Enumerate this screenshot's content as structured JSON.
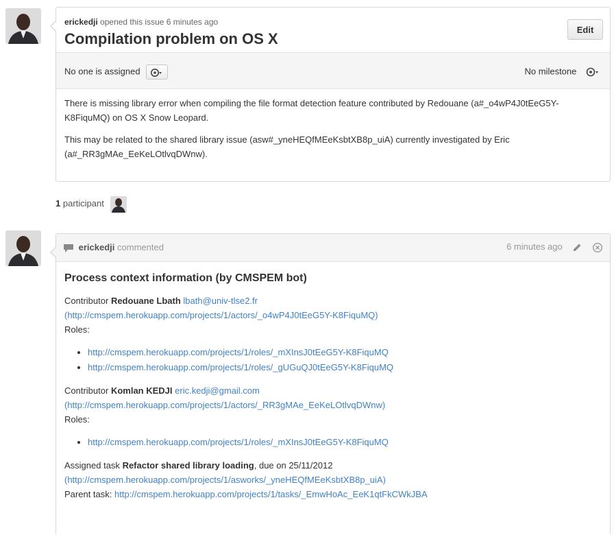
{
  "issue": {
    "author": "erickedji",
    "opened_suffix": "opened this issue 6 minutes ago",
    "title": "Compilation problem on OS X",
    "edit_label": "Edit",
    "assignee_text": "No one is assigned",
    "milestone_text": "No milestone",
    "body": [
      "There is missing library error when compiling the file format detection feature contributed by Redouane (a#_o4wP4J0tEeG5Y-K8FiquMQ) on OS X Snow Leopard.",
      "This may be related to the shared library issue (asw#_yneHEQfMEeKsbtXB8p_uiA) currently investigated by Eric (a#_RR3gMAe_EeKeLOtlvqDWnw)."
    ]
  },
  "participants": {
    "count": "1",
    "label": "participant"
  },
  "comment": {
    "author": "erickedji",
    "action": "commented",
    "time": "6 minutes ago",
    "heading": "Process context information (by CMSPEM bot)",
    "contributor_prefix": "Contributor",
    "roles_label": "Roles:",
    "contributors": [
      {
        "name": "Redouane Lbath",
        "email": "lbath@univ-tlse2.fr",
        "url": "(http://cmspem.herokuapp.com/projects/1/actors/_o4wP4J0tEeG5Y-K8FiquMQ)",
        "roles": [
          "http://cmspem.herokuapp.com/projects/1/roles/_mXInsJ0tEeG5Y-K8FiquMQ",
          "http://cmspem.herokuapp.com/projects/1/roles/_gUGuQJ0tEeG5Y-K8FiquMQ"
        ]
      },
      {
        "name": "Komlan KEDJI",
        "email": "eric.kedji@gmail.com",
        "url": "(http://cmspem.herokuapp.com/projects/1/actors/_RR3gMAe_EeKeLOtlvqDWnw)",
        "roles": [
          "http://cmspem.herokuapp.com/projects/1/roles/_mXInsJ0tEeG5Y-K8FiquMQ"
        ]
      }
    ],
    "task": {
      "prefix": "Assigned task",
      "name": "Refactor shared library loading",
      "due_text": ", due on 25/11/2012",
      "url": "(http://cmspem.herokuapp.com/projects/1/asworks/_yneHEQfMEeKsbtXB8p_uiA)",
      "parent_label": "Parent task:",
      "parent_url": "http://cmspem.herokuapp.com/projects/1/tasks/_EmwHoAc_EeK1qtFkCWkJBA"
    }
  },
  "colors": {
    "link": "#4183c4",
    "border": "#d8d8d8",
    "header_bg": "#f5f5f5"
  },
  "icons": {
    "settings": "gear-icon",
    "comment": "speech-bubble-icon",
    "edit": "pencil-icon",
    "delete": "close-circle-icon"
  }
}
